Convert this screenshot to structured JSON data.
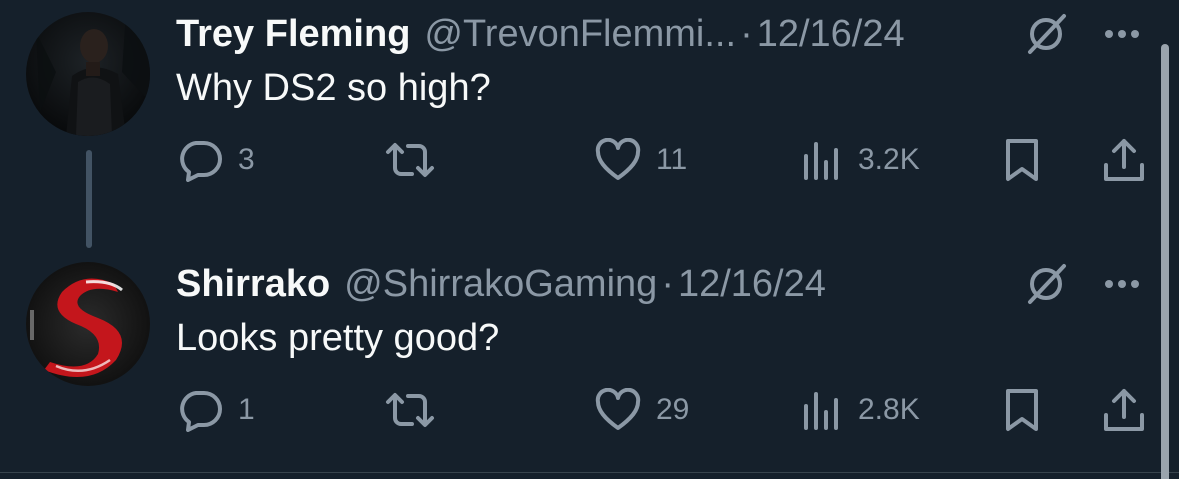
{
  "colors": {
    "background": "#15202b",
    "text_primary": "#f7f9f9",
    "text_secondary": "#8b98a5",
    "thread_line": "#425364"
  },
  "tweets": [
    {
      "display_name": "Trey Fleming",
      "handle": "@TrevonFlemmi...",
      "separator": "·",
      "date": "12/16/24",
      "text": "Why DS2 so high?",
      "replies": "3",
      "reposts": "",
      "likes": "11",
      "views": "3.2K",
      "avatar_alt": "Trey Fleming avatar",
      "icons": [
        "grok-icon",
        "more-icon",
        "reply-icon",
        "repost-icon",
        "like-icon",
        "views-icon",
        "bookmark-icon",
        "share-icon"
      ]
    },
    {
      "display_name": "Shirrako",
      "handle": "@ShirrakoGaming",
      "separator": "·",
      "date": "12/16/24",
      "text": "Looks pretty good?",
      "replies": "1",
      "reposts": "",
      "likes": "29",
      "views": "2.8K",
      "avatar_alt": "Shirrako avatar",
      "icons": [
        "grok-icon",
        "more-icon",
        "reply-icon",
        "repost-icon",
        "like-icon",
        "views-icon",
        "bookmark-icon",
        "share-icon"
      ]
    }
  ]
}
